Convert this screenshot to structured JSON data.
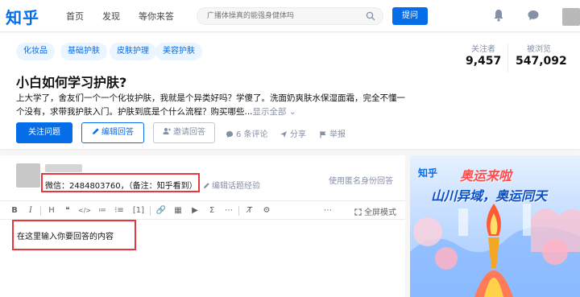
{
  "nav": {
    "logo": "知乎",
    "links": [
      "首页",
      "发现",
      "等你来答"
    ],
    "search_placeholder": "广播体操真的能强身健体吗",
    "ask_label": "提问"
  },
  "question": {
    "tags": [
      "化妆品",
      "基础护肤",
      "皮肤护理",
      "美容护肤"
    ],
    "title": "小白如何学习护肤?",
    "description": "上大学了，舍友们一个一个化妆护肤，我就是个异类好吗？学傻了。洗面奶爽肤水保湿面霜，完全不懂一个没有，求带我护肤入门。护肤到底是个什么流程？购买哪些...",
    "show_all": "显示全部 ⌄",
    "followers_label": "关注者",
    "followers_value": "9,457",
    "views_label": "被浏览",
    "views_value": "547,092",
    "follow_label": "关注问题",
    "answer_label": "编辑回答",
    "invite_label": "邀请回答",
    "comments_label": "6 条评论",
    "share_label": "分享",
    "report_label": "举报"
  },
  "editor": {
    "wechat_text": "微信：2484803760，（备注：知乎看到）",
    "edit_exp_label": "编辑话题经验",
    "anon_label": "使用匿名身份回答",
    "toolbar": [
      "B",
      "I",
      "H",
      "❝",
      "</>",
      "≔",
      "⁝≡",
      "[1]",
      "🔗",
      "▦",
      "▶",
      "Σ",
      "⋯",
      "T̸",
      "⚙",
      "⋯"
    ],
    "fullscreen_label": "全屏模式",
    "body_text": "在这里输入你要回答的内容"
  },
  "ad": {
    "logo": "知乎",
    "title": "奥运来啦",
    "subtitle": "山川异域，奥运同天"
  },
  "colors": {
    "brand": "#056de8",
    "highlight": "#e4393c"
  }
}
